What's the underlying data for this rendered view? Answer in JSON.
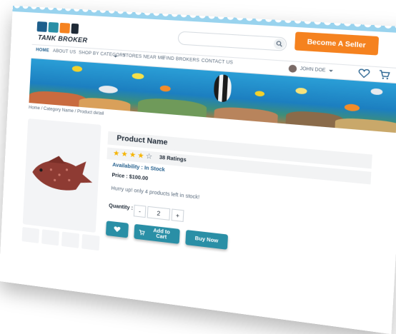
{
  "brand": {
    "logo_text": "TANK BROKER"
  },
  "header": {
    "search_placeholder": "",
    "seller_button": "Become A Seller"
  },
  "nav": {
    "items": [
      "HOME",
      "ABOUT US",
      "SHOP BY CATEGORY",
      "STORES NEAR ME",
      "FIND BROKERS",
      "CONTACT US"
    ],
    "active": "HOME",
    "user_name": "JOHN DOE"
  },
  "breadcrumb": [
    "Home",
    "Category Name",
    "Product detail"
  ],
  "product": {
    "name": "Product Name",
    "rating": 4,
    "rating_max": 5,
    "ratings_label": "38 Ratings",
    "availability_label": "Availability :",
    "availability_value": "In Stock",
    "price_label": "Price :",
    "price_value": "$100.00",
    "stock_note": "Hurry up! only 4 products left in stock!",
    "quantity_label": "Quantity :",
    "quantity": "2",
    "minus": "-",
    "plus": "+"
  },
  "actions": {
    "add_to_cart": "Add to Cart",
    "buy_now": "Buy Now"
  },
  "colors": {
    "accent": "#2a8fa6",
    "seller": "#f5821f",
    "star": "#f5b400"
  }
}
